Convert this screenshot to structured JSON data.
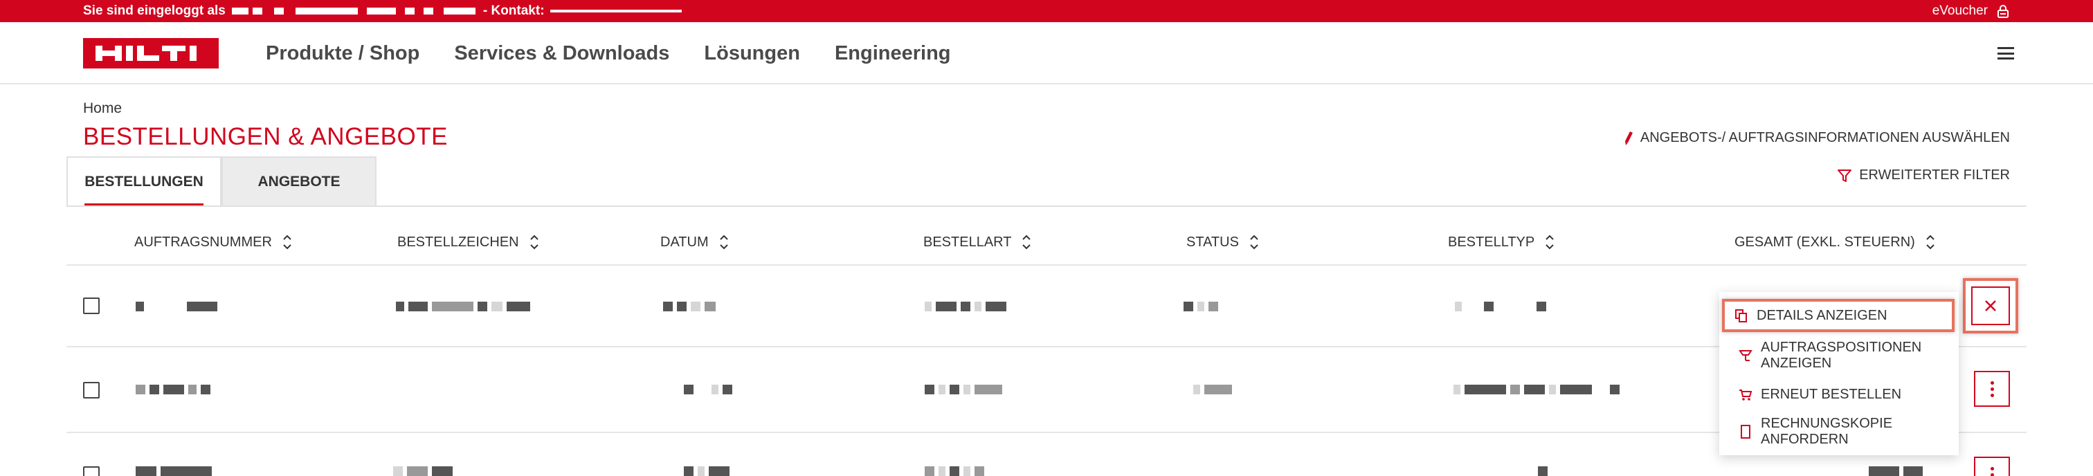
{
  "topbar": {
    "login_prefix": "Sie sind eingeloggt als",
    "contact_label": "- Kontakt:",
    "evoucher": "eVoucher"
  },
  "header": {
    "logo_text": "HILTI",
    "nav": [
      "Produkte / Shop",
      "Services & Downloads",
      "Lösungen",
      "Engineering"
    ]
  },
  "breadcrumb": "Home",
  "page_title": "BESTELLUNGEN & ANGEBOTE",
  "tabs": [
    "BESTELLUNGEN",
    "ANGEBOTE"
  ],
  "actions": {
    "select_info": "ANGEBOTS-/ AUFTRAGSINFORMATIONEN AUSWÄHLEN",
    "advanced_filter": "ERWEITERTER FILTER"
  },
  "table": {
    "columns": [
      "AUFTRAGSNUMMER",
      "BESTELLZEICHEN",
      "DATUM",
      "BESTELLART",
      "STATUS",
      "BESTELLTYP",
      "GESAMT (EXKL. STEUERN)"
    ]
  },
  "row_menu": {
    "items": [
      {
        "label": "DETAILS ANZEIGEN",
        "icon": "copy-icon"
      },
      {
        "label_line1": "AUFTRAGSPOSITIONEN",
        "label_line2": "ANZEIGEN",
        "icon": "list-icon"
      },
      {
        "label": "ERNEUT BESTELLEN",
        "icon": "cart-icon"
      },
      {
        "label_line1": "RECHNUNGSKOPIE",
        "label_line2": "ANFORDERN",
        "icon": "document-icon"
      }
    ]
  },
  "colors": {
    "brand_red": "#d2051e",
    "highlight": "#e8725e"
  }
}
